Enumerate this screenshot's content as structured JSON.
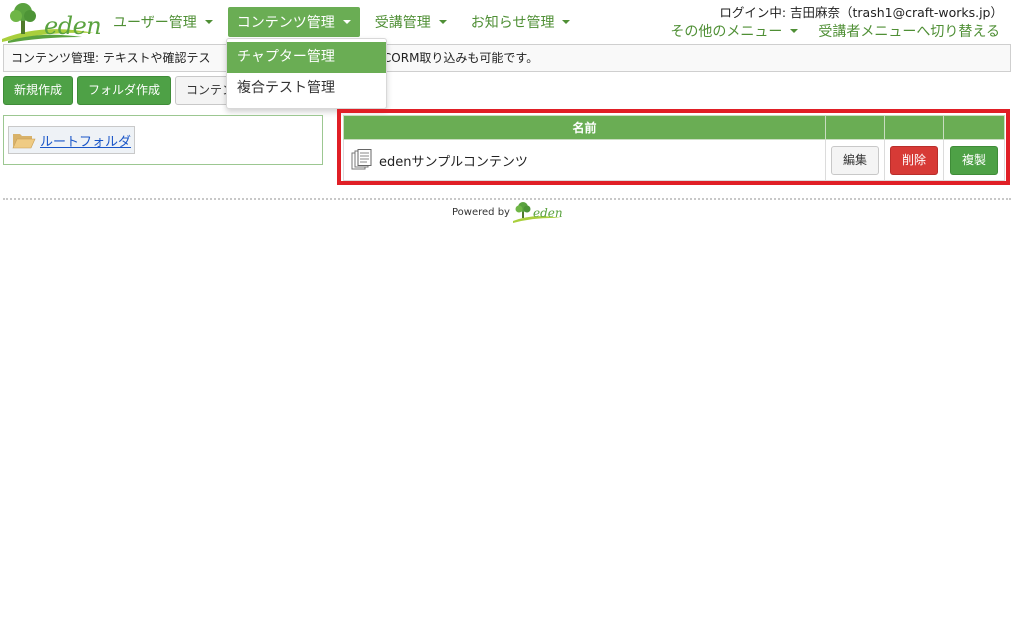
{
  "header": {
    "logo_text": "eden",
    "nav": [
      {
        "label": "ユーザー管理"
      },
      {
        "label": "コンテンツ管理"
      },
      {
        "label": "受講管理"
      },
      {
        "label": "お知らせ管理"
      }
    ],
    "login_info": "ログイン中: 吉田麻奈（trash1@craft-works.jp）",
    "other_menu_label": "その他のメニュー",
    "switch_menu_label": "受講者メニューへ切り替える"
  },
  "description": {
    "before": "コンテンツ管理: テキストや確認テス",
    "after": "します。SCORM取り込みも可能です。"
  },
  "toolbar": {
    "new_label": "新規作成",
    "folder_label": "フォルダ作成",
    "other_label": "コンテンツ"
  },
  "dropdown": {
    "items": [
      {
        "label": "チャプター管理"
      },
      {
        "label": "複合テスト管理"
      }
    ]
  },
  "tree": {
    "root_label": "ルートフォルダ"
  },
  "table": {
    "header_name": "名前",
    "rows": [
      {
        "name": "edenサンプルコンテンツ",
        "edit_label": "編集",
        "delete_label": "削除",
        "copy_label": "複製"
      }
    ]
  },
  "footer": {
    "powered_by": "Powered by",
    "logo_text": "eden"
  },
  "colors": {
    "brand_green": "#6aad54",
    "button_green": "#4ea146",
    "danger_red": "#d73a36",
    "highlight_red": "#e01f26",
    "link_blue": "#1a56c8"
  }
}
